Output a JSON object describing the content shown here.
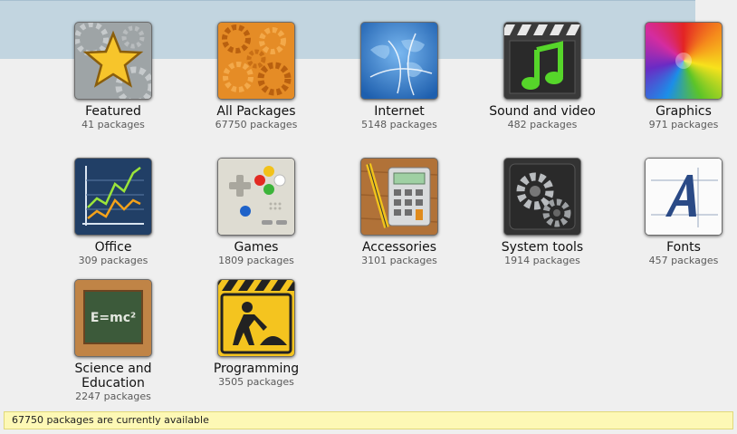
{
  "categories": [
    {
      "name": "Featured",
      "count": "41 packages",
      "icon": "featured-star-icon"
    },
    {
      "name": "All Packages",
      "count": "67750 packages",
      "icon": "all-packages-gears-icon"
    },
    {
      "name": "Internet",
      "count": "5148 packages",
      "icon": "internet-globe-icon"
    },
    {
      "name": "Sound and video",
      "count": "482 packages",
      "icon": "sound-video-icon"
    },
    {
      "name": "Graphics",
      "count": "971 packages",
      "icon": "graphics-palette-icon"
    },
    {
      "name": "Office",
      "count": "309 packages",
      "icon": "office-chart-icon"
    },
    {
      "name": "Games",
      "count": "1809 packages",
      "icon": "games-console-icon"
    },
    {
      "name": "Accessories",
      "count": "3101 packages",
      "icon": "accessories-calculator-icon"
    },
    {
      "name": "System tools",
      "count": "1914 packages",
      "icon": "system-tools-gears-icon"
    },
    {
      "name": "Fonts",
      "count": "457 packages",
      "icon": "fonts-letter-icon"
    },
    {
      "name": "Science and Education",
      "count": "2247 packages",
      "icon": "science-chalkboard-icon"
    },
    {
      "name": "Programming",
      "count": "3505 packages",
      "icon": "programming-construction-icon"
    }
  ],
  "science_formula": "E=mc²",
  "status": {
    "text": "67750 packages are currently available"
  }
}
